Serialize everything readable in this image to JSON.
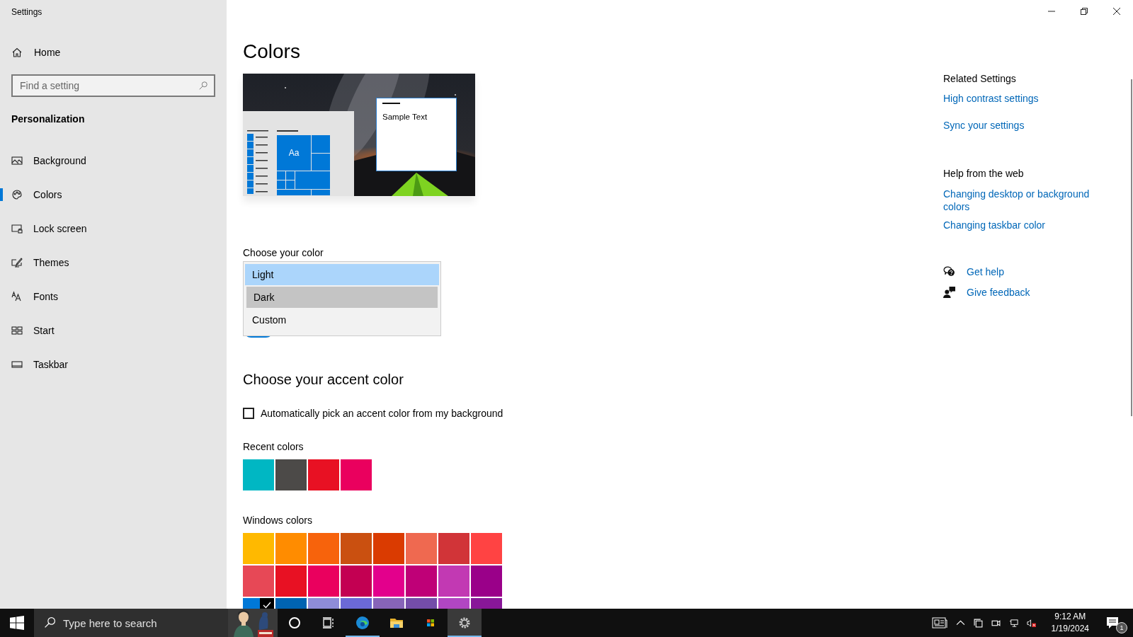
{
  "window": {
    "title": "Settings"
  },
  "sidebar": {
    "home": "Home",
    "search": {
      "placeholder": "Find a setting"
    },
    "section": "Personalization",
    "items": [
      {
        "kind": "background",
        "label": "Background",
        "selected": false
      },
      {
        "kind": "colors",
        "label": "Colors",
        "selected": true
      },
      {
        "kind": "lock",
        "label": "Lock screen",
        "selected": false
      },
      {
        "kind": "themes",
        "label": "Themes",
        "selected": false
      },
      {
        "kind": "fonts",
        "label": "Fonts",
        "selected": false
      },
      {
        "kind": "start",
        "label": "Start",
        "selected": false
      },
      {
        "kind": "taskbar",
        "label": "Taskbar",
        "selected": false
      }
    ]
  },
  "page": {
    "title": "Colors",
    "preview": {
      "tile_text": "Aa",
      "sample_text": "Sample Text"
    },
    "choose_color": {
      "label": "Choose your color",
      "options": [
        {
          "label": "Light",
          "selected": true,
          "hovered": false
        },
        {
          "label": "Dark",
          "selected": false,
          "hovered": true
        },
        {
          "label": "Custom",
          "selected": false,
          "hovered": false
        }
      ],
      "toggle": {
        "on": true
      }
    },
    "accent": {
      "title": "Choose your accent color",
      "auto_pick": {
        "label": "Automatically pick an accent color from my background",
        "checked": false
      },
      "recent": {
        "label": "Recent colors",
        "swatches": [
          {
            "color": "#00b7c3"
          },
          {
            "color": "#4c4a48"
          },
          {
            "color": "#e81123"
          },
          {
            "color": "#ea005e"
          }
        ]
      },
      "windows": {
        "label": "Windows colors",
        "swatches": [
          {
            "color": "#ffb900",
            "selected": false
          },
          {
            "color": "#ff8c00",
            "selected": false
          },
          {
            "color": "#f7630c",
            "selected": false
          },
          {
            "color": "#ca5010",
            "selected": false
          },
          {
            "color": "#da3b01",
            "selected": false
          },
          {
            "color": "#ef6950",
            "selected": false
          },
          {
            "color": "#d13438",
            "selected": false
          },
          {
            "color": "#ff4343",
            "selected": false
          },
          {
            "color": "#e74856",
            "selected": false
          },
          {
            "color": "#e81123",
            "selected": false
          },
          {
            "color": "#ea005e",
            "selected": false
          },
          {
            "color": "#c30052",
            "selected": false
          },
          {
            "color": "#e3008c",
            "selected": false
          },
          {
            "color": "#bf0077",
            "selected": false
          },
          {
            "color": "#c239b3",
            "selected": false
          },
          {
            "color": "#9a0089",
            "selected": false
          },
          {
            "color": "#0078d7",
            "selected": true
          },
          {
            "color": "#0063b1",
            "selected": false
          },
          {
            "color": "#8e8cd8",
            "selected": false
          },
          {
            "color": "#6b69d6",
            "selected": false
          },
          {
            "color": "#8764b8",
            "selected": false
          },
          {
            "color": "#744da9",
            "selected": false
          },
          {
            "color": "#b146c2",
            "selected": false
          },
          {
            "color": "#881798",
            "selected": false
          }
        ]
      }
    }
  },
  "related": {
    "title": "Related Settings",
    "links": [
      "High contrast settings",
      "Sync your settings"
    ]
  },
  "help_web": {
    "title": "Help from the web",
    "links": [
      "Changing desktop or background colors",
      "Changing taskbar color"
    ]
  },
  "support": [
    {
      "kind": "help",
      "label": "Get help"
    },
    {
      "kind": "feedback",
      "label": "Give feedback"
    }
  ],
  "taskbar": {
    "search_placeholder": "Type here to search",
    "apps": [
      {
        "kind": "cortana",
        "running": false,
        "active": false
      },
      {
        "kind": "taskview",
        "running": false,
        "active": false
      },
      {
        "kind": "edge",
        "running": true,
        "active": false
      },
      {
        "kind": "explorer",
        "running": false,
        "active": false
      },
      {
        "kind": "store",
        "running": false,
        "active": false
      },
      {
        "kind": "settings",
        "running": true,
        "active": true
      }
    ],
    "time": "9:12 AM",
    "date": "1/19/2024",
    "notifications": "1"
  }
}
